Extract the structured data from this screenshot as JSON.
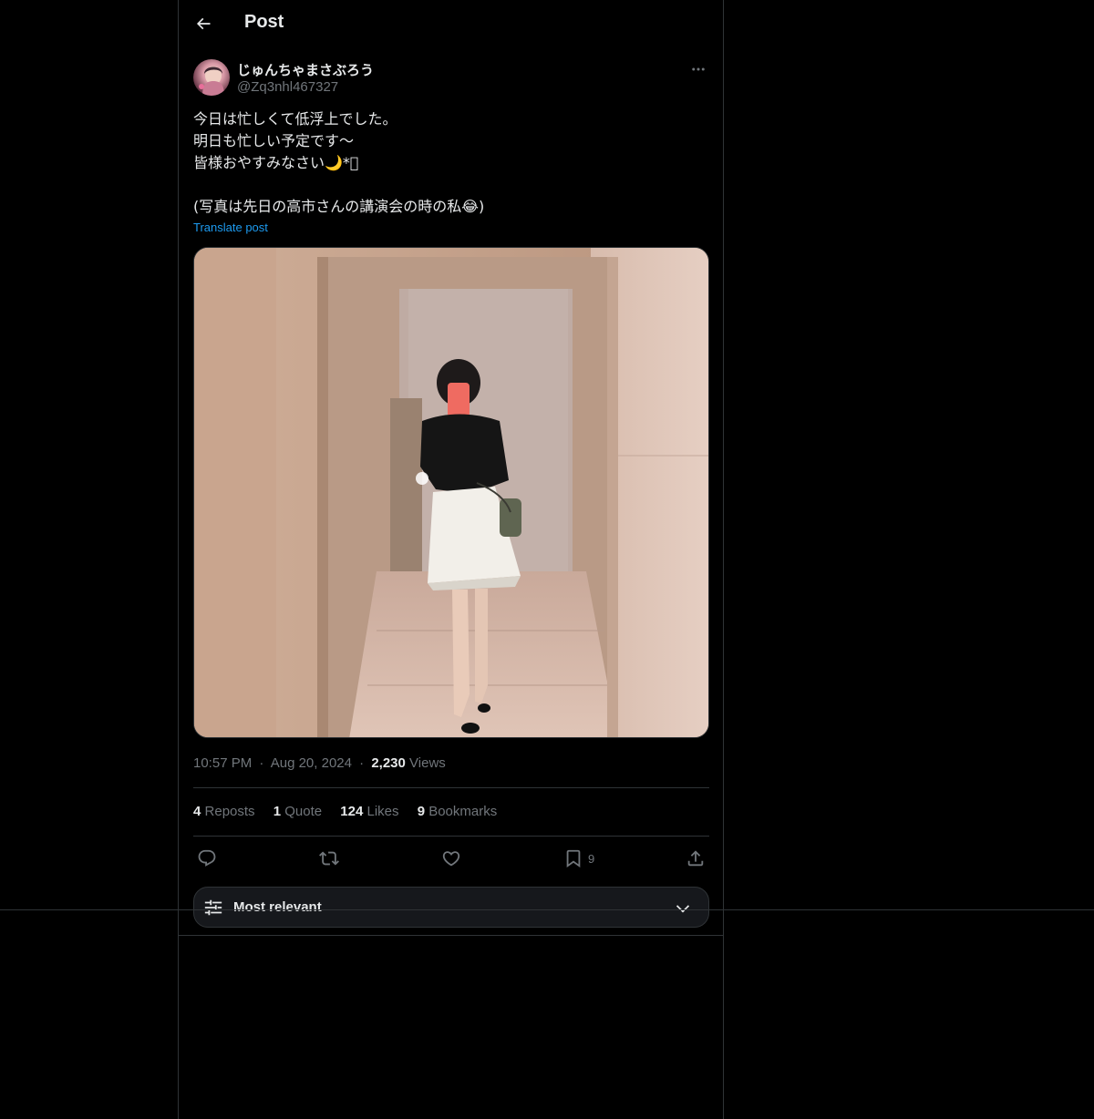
{
  "header": {
    "title": "Post"
  },
  "author": {
    "display_name": "じゅんちゃまさぶろう",
    "handle": "@Zq3nhl467327"
  },
  "post": {
    "text": "今日は忙しくて低浮上でした。\n明日も忙しい予定です〜\n皆様おやすみなさい🌙*ﾟ\n\n(写真は先日の高市さんの講演会の時の私😂)",
    "translate_label": "Translate post",
    "time": "10:57 PM",
    "date": "Aug 20, 2024",
    "views_count": "2,230",
    "views_label": "Views",
    "separator": "·"
  },
  "stats": {
    "reposts_count": "4",
    "reposts_label": "Reposts",
    "quotes_count": "1",
    "quotes_label": "Quote",
    "likes_count": "124",
    "likes_label": "Likes",
    "bookmarks_count": "9",
    "bookmarks_label": "Bookmarks"
  },
  "actions": {
    "bookmark_count": "9"
  },
  "sort": {
    "label": "Most relevant"
  },
  "colors": {
    "background": "#000000",
    "text": "#e7e9ea",
    "muted": "#71767b",
    "accent": "#1d9bf0",
    "border": "#2f3336"
  },
  "icons": {
    "back": "arrow-left-icon",
    "more": "more-horizontal-icon",
    "reply": "reply-icon",
    "repost": "repost-icon",
    "like": "heart-icon",
    "bookmark": "bookmark-icon",
    "share": "share-icon",
    "sort": "sliders-icon",
    "chevron": "chevron-down-icon"
  }
}
